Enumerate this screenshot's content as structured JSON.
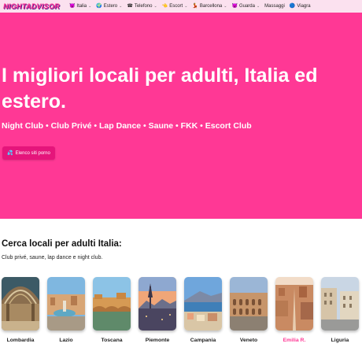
{
  "nav": {
    "logo": "NIGHTADVISOR",
    "items": [
      {
        "label": "Italia",
        "icon": "😈",
        "dropdown": true
      },
      {
        "label": "Estero",
        "icon": "🌍",
        "dropdown": true
      },
      {
        "label": "Telefono",
        "icon": "☎",
        "dropdown": true
      },
      {
        "label": "Escort",
        "icon": "👈",
        "dropdown": true
      },
      {
        "label": "Barcellona",
        "icon": "💃",
        "dropdown": true
      },
      {
        "label": "Guarda",
        "icon": "😈",
        "dropdown": true
      },
      {
        "label": "Massaggi",
        "icon": "",
        "dropdown": false
      },
      {
        "label": "Viagra",
        "icon": "🔵",
        "dropdown": false
      }
    ]
  },
  "hero": {
    "title": "I migliori locali per adulti, Italia ed estero.",
    "subtitle": "Night Club • Club Privé • Lap Dance • Saune • FKK • Escort Club",
    "button_label": "Elenco siti porno",
    "button_icon": "💦",
    "bg_color": "#ff3895"
  },
  "section": {
    "title": "Cerca locali per adulti Italia:",
    "subtitle": "Club privé, saune, lap dance e night club.",
    "regions": [
      {
        "label": "Lombardia",
        "active": false
      },
      {
        "label": "Lazio",
        "active": false
      },
      {
        "label": "Toscana",
        "active": false
      },
      {
        "label": "Piemonte",
        "active": false
      },
      {
        "label": "Campania",
        "active": false
      },
      {
        "label": "Veneto",
        "active": false
      },
      {
        "label": "Emilia R.",
        "active": true
      },
      {
        "label": "Liguria",
        "active": false
      }
    ]
  }
}
